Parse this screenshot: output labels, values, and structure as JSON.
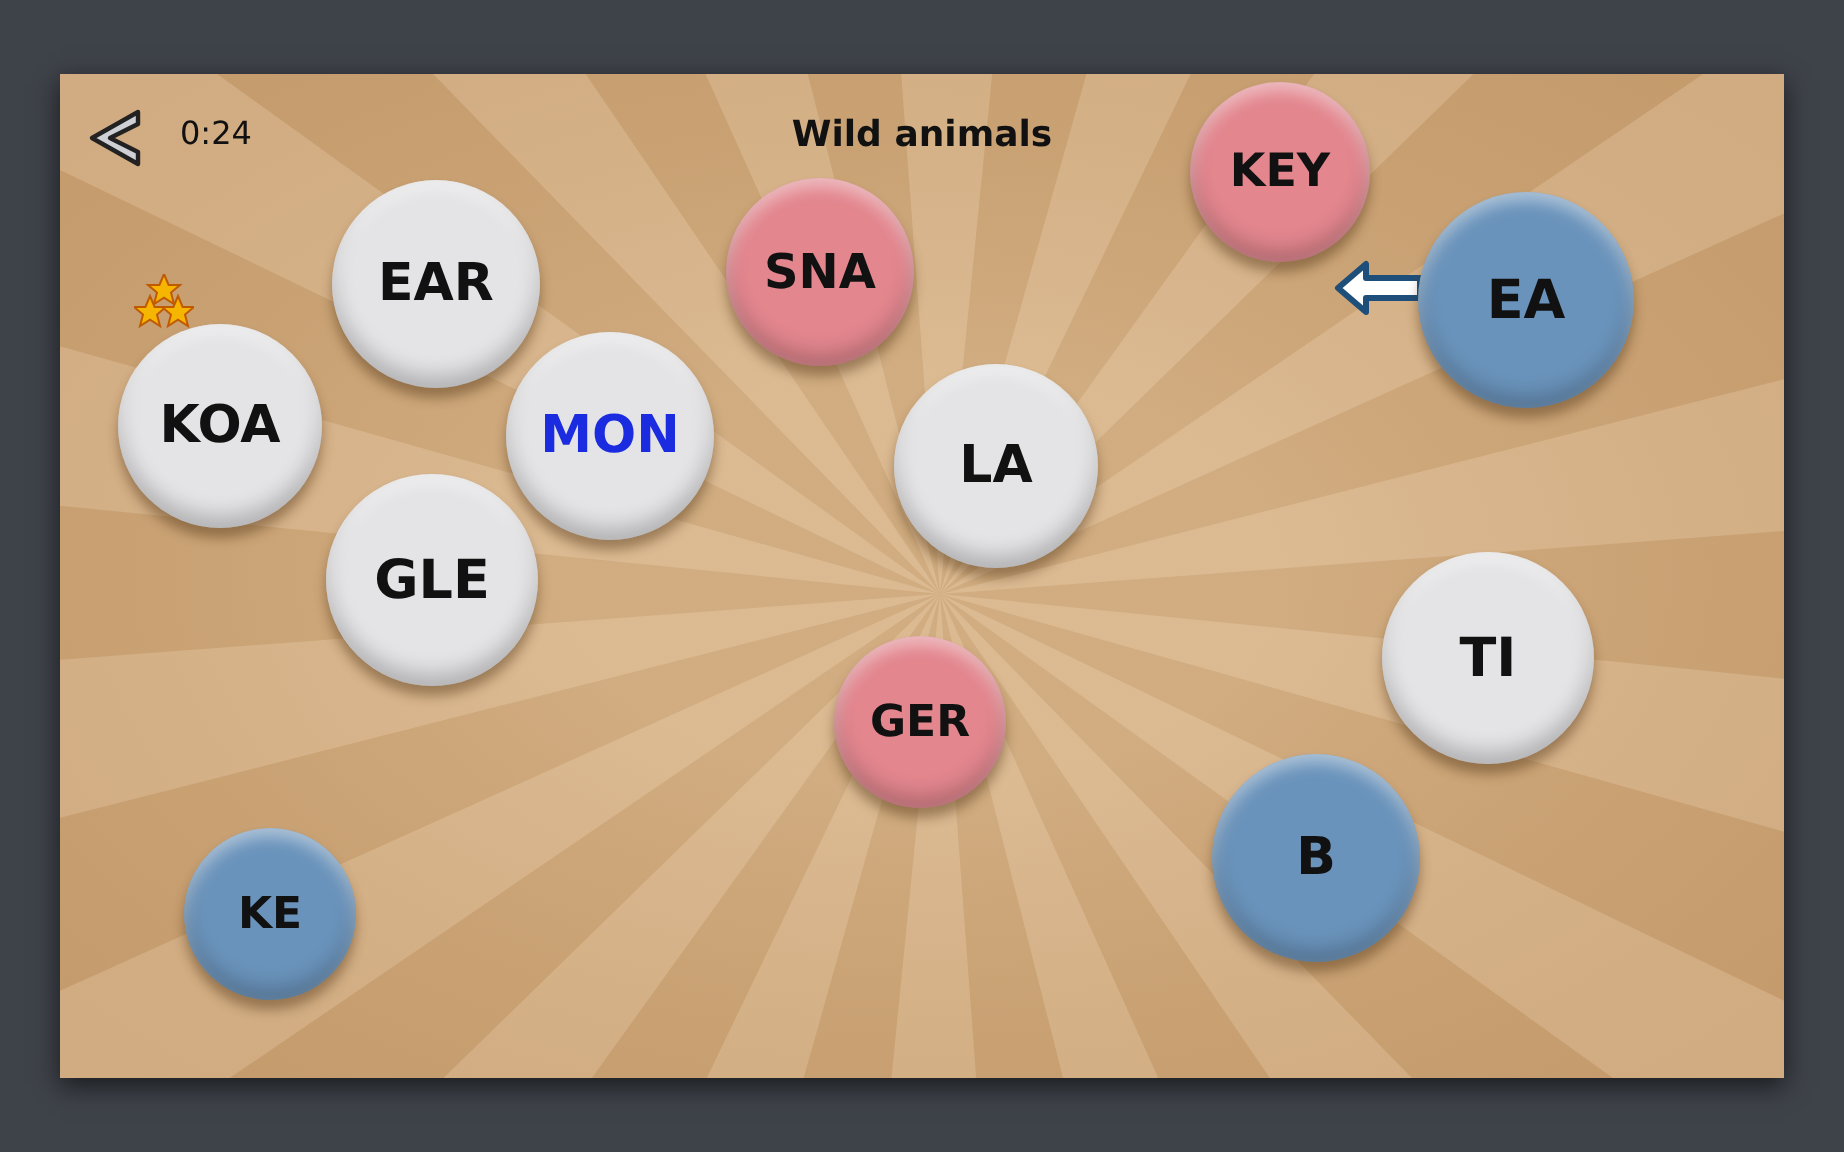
{
  "header": {
    "timer": "0:24",
    "title": "Wild animals"
  },
  "bubbles": [
    {
      "text": "EAR",
      "color": "#e4e4e6",
      "selected": false
    },
    {
      "text": "SNA",
      "color": "#e3868e",
      "selected": false
    },
    {
      "text": "KEY",
      "color": "#e3868e",
      "selected": false
    },
    {
      "text": "EA",
      "color": "#6a93bb",
      "selected": false
    },
    {
      "text": "KOA",
      "color": "#e4e4e6",
      "selected": false
    },
    {
      "text": "MON",
      "color": "#e4e4e6",
      "selected": true
    },
    {
      "text": "LA",
      "color": "#e4e4e6",
      "selected": false
    },
    {
      "text": "GLE",
      "color": "#e4e4e6",
      "selected": false
    },
    {
      "text": "TI",
      "color": "#e4e4e6",
      "selected": false
    },
    {
      "text": "GER",
      "color": "#e3868e",
      "selected": false
    },
    {
      "text": "B",
      "color": "#6a93bb",
      "selected": false
    },
    {
      "text": "KE",
      "color": "#6a93bb",
      "selected": false
    }
  ]
}
